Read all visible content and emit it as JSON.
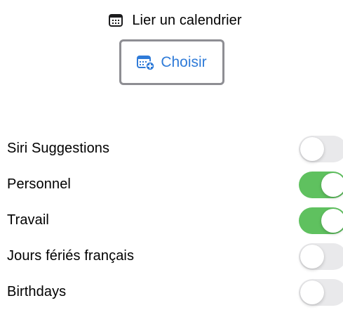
{
  "header": {
    "icon": "calendar-icon",
    "title": "Lier un calendrier"
  },
  "choose_button": {
    "icon": "calendar-add-icon",
    "label": "Choisir"
  },
  "colors": {
    "accent": "#2f7bd8",
    "toggle_on": "#5fc15f",
    "toggle_off": "#e9e9eb",
    "button_border": "#8e8e93"
  },
  "calendars": [
    {
      "label": "Siri Suggestions",
      "enabled": false
    },
    {
      "label": "Personnel",
      "enabled": true
    },
    {
      "label": "Travail",
      "enabled": true
    },
    {
      "label": "Jours fériés français",
      "enabled": false
    },
    {
      "label": "Birthdays",
      "enabled": false
    }
  ]
}
